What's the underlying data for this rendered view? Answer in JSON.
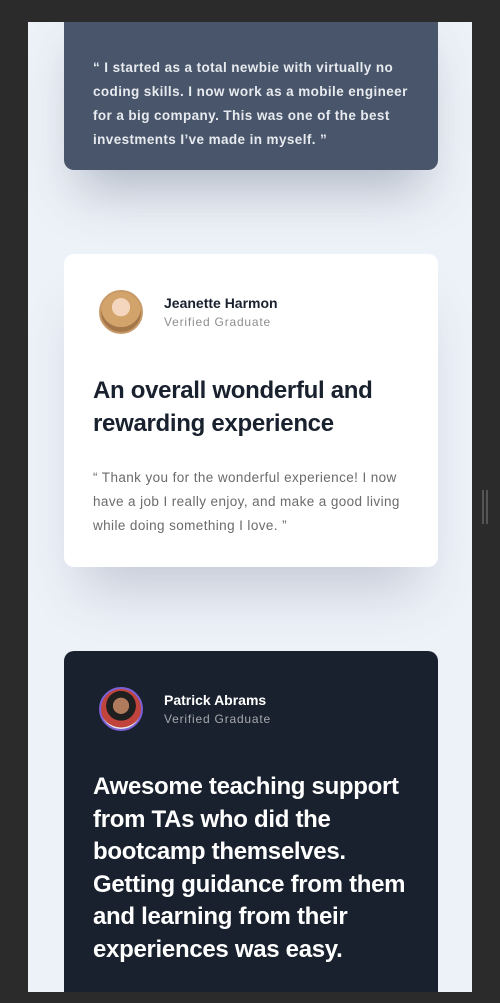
{
  "testimonials": [
    {
      "quote": "“ I started as a total newbie with virtually no coding skills. I now work as a mobile engineer for a big company. This was one of the best investments I’ve made in myself. ”"
    },
    {
      "name": "Jeanette Harmon",
      "role": "Verified Graduate",
      "headline": "An overall wonderful and rewarding experience",
      "quote": "“ Thank you for the wonderful experience! I now have a job I really enjoy, and make a good living while doing something I love. ”"
    },
    {
      "name": "Patrick Abrams",
      "role": "Verified Graduate",
      "headline": "Awesome teaching support from TAs who did the bootcamp themselves. Getting guidance from them and learning from their experiences was easy."
    }
  ],
  "colors": {
    "background": "#edf1f8",
    "card_slate": "#48556a",
    "card_white": "#ffffff",
    "card_dark": "#19212e",
    "avatar_ring_purple": "#7c60d6"
  },
  "icons": [
    "avatar-photo"
  ]
}
